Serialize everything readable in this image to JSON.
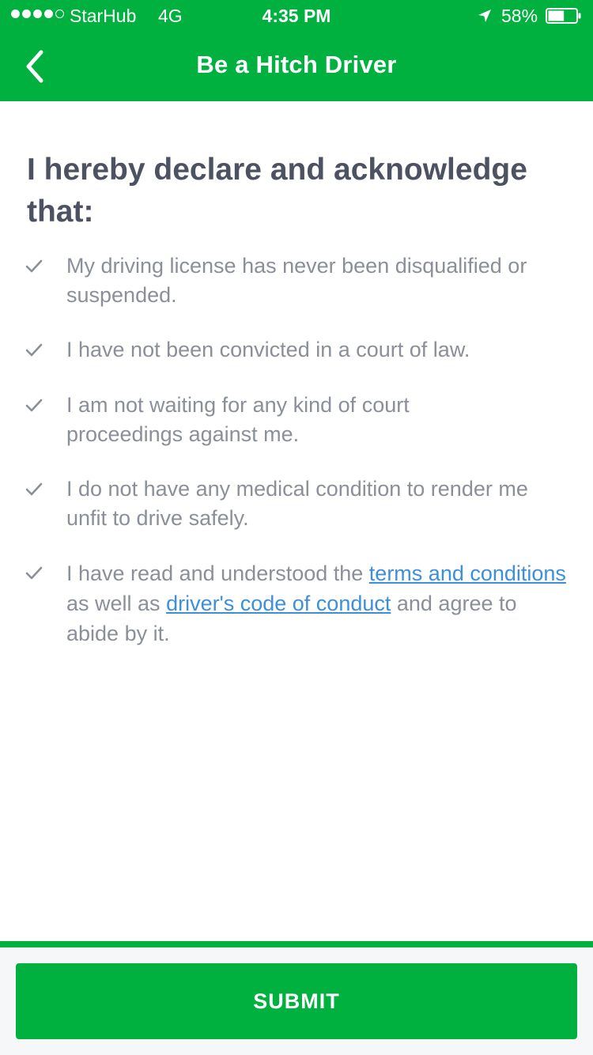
{
  "status_bar": {
    "carrier": "StarHub",
    "network": "4G",
    "time": "4:35 PM",
    "battery": "58%",
    "signal_strength": "4 of 5 bars",
    "battery_level": 0.58,
    "icons": [
      "location-arrow-icon",
      "battery-icon"
    ]
  },
  "nav": {
    "title": "Be a Hitch Driver",
    "back_icon": "chevron-left-icon"
  },
  "colors": {
    "brand_green": "#00b140",
    "heading": "#4c5261",
    "body_text": "#8a8f99",
    "link": "#3d8fdb"
  },
  "declaration": {
    "heading": "I hereby declare and acknowledge that:",
    "items": [
      {
        "text": "My driving license has never been disqualified or suspended."
      },
      {
        "text": "I have not been convicted in a court of law."
      },
      {
        "text": "I am not waiting for any kind of court proceedings against me."
      },
      {
        "text": "I do not have any medical condition to render me unfit to drive safely."
      },
      {
        "text_before": "I have read and understood the ",
        "link1": "terms and conditions",
        "text_middle": " as well as ",
        "link2": "driver's code of conduct",
        "text_after": " and agree to abide by it."
      }
    ]
  },
  "footer": {
    "submit_label": "SUBMIT"
  }
}
